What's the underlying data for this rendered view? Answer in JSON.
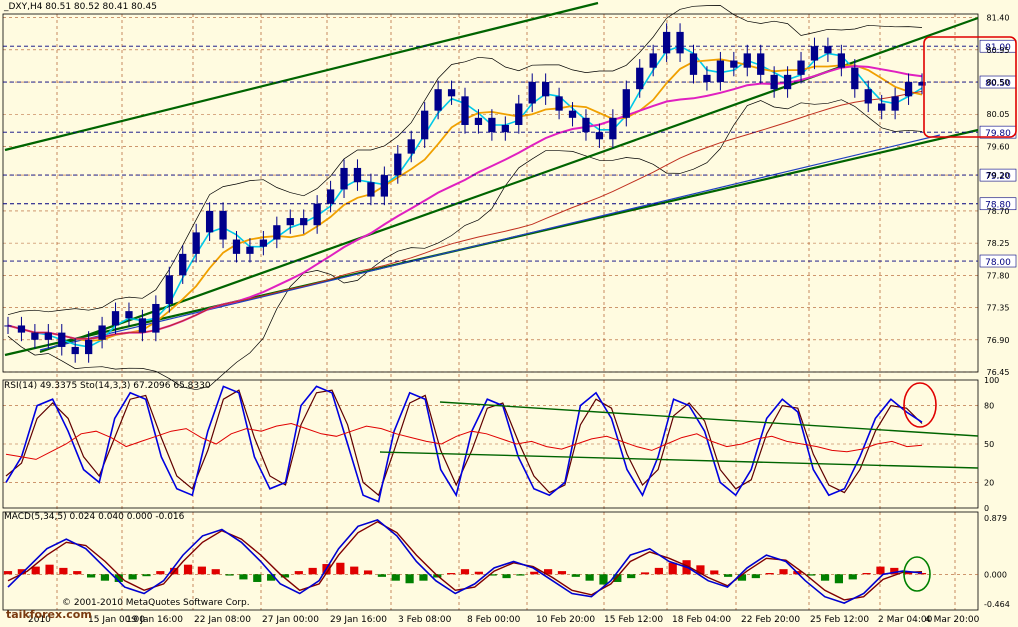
{
  "title": "_DXY,H4  80.51 80.52 80.41 80.45",
  "rsi_label": "RSI(14) 49.3375  Sto(14,3,3) 67.2096 65.8330",
  "macd_label": "MACD(5,34,5) 0.024 0.040 0.000 -0.016",
  "copyright": "© 2001-2010 MetaQuotes Software Corp.",
  "watermark": "taikforex.com",
  "colors": {
    "background": "#fffbe0",
    "grid": "#b05a28",
    "candle": "#00008b",
    "ma_cyan": "#00c8e8",
    "ma_orange": "#f0a000",
    "ma_magenta": "#e020c0",
    "ma_red": "#c03020",
    "ma_blue": "#2040c0",
    "bollinger": "#000000",
    "trendline": "#006400",
    "rsi_red": "#e00000",
    "sto_blue": "#0000e0",
    "macd_pos": "#e00000",
    "macd_neg": "#008000",
    "annot_red": "#e00000",
    "annot_green": "#008000"
  },
  "chart_data": [
    {
      "type": "line",
      "name": "price",
      "ylim": [
        76.45,
        81.45
      ],
      "x": [
        "19 Jan 16:00",
        "22 Jan 08:00",
        "27 Jan 00:00",
        "29 Jan 16:00",
        "3 Feb 08:00",
        "8 Feb 00:00",
        "10 Feb 20:00",
        "15 Feb 12:00",
        "18 Feb 04:00",
        "22 Feb 20:00",
        "25 Feb 12:00",
        "2 Mar 04:00",
        "4 Mar 20:00"
      ],
      "x_ticks_left": [
        "2010",
        "15 Jan 00:00"
      ],
      "y_ticks": [
        81.4,
        80.95,
        80.5,
        80.05,
        79.6,
        79.2,
        78.7,
        78.25,
        77.8,
        77.35,
        76.9,
        76.45
      ],
      "levels": [
        {
          "label": "81.00",
          "value": 81.0
        },
        {
          "label": "80.50",
          "value": 80.5
        },
        {
          "label": "79.80",
          "value": 79.8
        },
        {
          "label": "79.20",
          "value": 79.2
        },
        {
          "label": "78.80",
          "value": 78.8
        },
        {
          "label": "78.00",
          "value": 78.0
        }
      ],
      "close": [
        77.1,
        77.0,
        76.9,
        77.0,
        76.8,
        76.7,
        76.9,
        77.1,
        77.3,
        77.2,
        77.0,
        77.4,
        77.8,
        78.1,
        78.4,
        78.7,
        78.3,
        78.1,
        78.2,
        78.3,
        78.5,
        78.6,
        78.5,
        78.8,
        79.0,
        79.3,
        79.1,
        78.9,
        79.2,
        79.5,
        79.7,
        80.1,
        80.4,
        80.3,
        79.9,
        80.0,
        79.8,
        79.9,
        80.2,
        80.5,
        80.3,
        80.1,
        80.0,
        79.8,
        79.7,
        80.0,
        80.4,
        80.7,
        80.9,
        81.2,
        80.9,
        80.6,
        80.5,
        80.8,
        80.7,
        80.9,
        80.6,
        80.4,
        80.6,
        80.8,
        81.0,
        80.9,
        80.7,
        80.4,
        80.2,
        80.1,
        80.3,
        80.5,
        80.45
      ]
    },
    {
      "type": "line",
      "name": "RSI / Stochastic",
      "ylim": [
        0,
        100
      ],
      "y_ticks": [
        100,
        80,
        50,
        20,
        0
      ],
      "rsi": [
        42,
        40,
        38,
        44,
        50,
        58,
        60,
        55,
        48,
        52,
        56,
        60,
        62,
        55,
        50,
        58,
        62,
        60,
        64,
        66,
        62,
        58,
        56,
        60,
        64,
        62,
        58,
        55,
        52,
        50,
        56,
        60,
        58,
        54,
        50,
        52,
        48,
        46,
        50,
        54,
        56,
        52,
        48,
        45,
        50,
        55,
        58,
        52,
        48,
        50,
        54,
        56,
        52,
        50,
        48,
        45,
        44,
        46,
        50,
        52,
        48,
        49
      ],
      "sto_main": [
        20,
        40,
        80,
        85,
        60,
        30,
        20,
        70,
        90,
        85,
        40,
        15,
        10,
        60,
        95,
        90,
        40,
        15,
        20,
        80,
        95,
        90,
        50,
        10,
        5,
        60,
        90,
        85,
        30,
        10,
        60,
        85,
        80,
        40,
        15,
        10,
        20,
        80,
        90,
        70,
        30,
        10,
        40,
        85,
        80,
        60,
        20,
        10,
        30,
        70,
        85,
        75,
        30,
        10,
        15,
        40,
        70,
        85,
        75,
        67
      ],
      "sto_signal": [
        25,
        35,
        70,
        82,
        70,
        40,
        25,
        55,
        85,
        88,
        55,
        25,
        15,
        45,
        85,
        92,
        55,
        25,
        18,
        65,
        90,
        92,
        65,
        20,
        10,
        45,
        82,
        88,
        45,
        18,
        45,
        78,
        82,
        52,
        25,
        12,
        18,
        65,
        85,
        78,
        42,
        18,
        30,
        72,
        82,
        68,
        30,
        15,
        22,
        58,
        80,
        78,
        42,
        18,
        12,
        30,
        60,
        80,
        78,
        66
      ]
    },
    {
      "type": "bar",
      "name": "MACD",
      "ylim": [
        -0.464,
        0.879
      ],
      "y_ticks": [
        0.879,
        0.0,
        -0.464
      ],
      "histogram": [
        0.05,
        0.08,
        0.12,
        0.15,
        0.1,
        0.05,
        -0.05,
        -0.1,
        -0.12,
        -0.08,
        -0.03,
        0.05,
        0.1,
        0.15,
        0.12,
        0.08,
        -0.02,
        -0.08,
        -0.12,
        -0.1,
        -0.05,
        0.05,
        0.1,
        0.16,
        0.18,
        0.12,
        0.06,
        -0.04,
        -0.1,
        -0.14,
        -0.1,
        -0.05,
        0.02,
        0.08,
        0.04,
        -0.02,
        -0.06,
        -0.02,
        0.04,
        0.08,
        0.05,
        -0.04,
        -0.1,
        -0.16,
        -0.12,
        -0.06,
        0.03,
        0.1,
        0.18,
        0.22,
        0.14,
        0.06,
        -0.04,
        -0.1,
        -0.06,
        0.02,
        0.08,
        0.05,
        -0.02,
        -0.1,
        -0.14,
        -0.08,
        0.02,
        0.12,
        0.1,
        0.04,
        0.02
      ],
      "macd": [
        -0.2,
        0.1,
        0.4,
        0.55,
        0.4,
        0.1,
        -0.2,
        -0.3,
        -0.1,
        0.3,
        0.6,
        0.7,
        0.5,
        0.2,
        -0.15,
        -0.3,
        -0.1,
        0.4,
        0.75,
        0.85,
        0.6,
        0.2,
        -0.1,
        -0.3,
        -0.15,
        0.1,
        0.2,
        0.1,
        -0.1,
        -0.3,
        -0.35,
        -0.1,
        0.3,
        0.4,
        0.2,
        0.1,
        -0.1,
        -0.2,
        0.1,
        0.3,
        0.2,
        -0.1,
        -0.35,
        -0.45,
        -0.3,
        0.0,
        0.05,
        0.02
      ],
      "signal": [
        -0.1,
        0.05,
        0.3,
        0.5,
        0.45,
        0.2,
        -0.1,
        -0.25,
        -0.15,
        0.2,
        0.5,
        0.68,
        0.55,
        0.3,
        0.0,
        -0.25,
        -0.15,
        0.3,
        0.65,
        0.82,
        0.65,
        0.3,
        0.0,
        -0.25,
        -0.2,
        0.05,
        0.18,
        0.12,
        -0.05,
        -0.25,
        -0.32,
        -0.15,
        0.2,
        0.35,
        0.25,
        0.12,
        -0.05,
        -0.18,
        0.05,
        0.25,
        0.22,
        0.0,
        -0.25,
        -0.4,
        -0.35,
        -0.08,
        0.03,
        0.04
      ]
    }
  ]
}
